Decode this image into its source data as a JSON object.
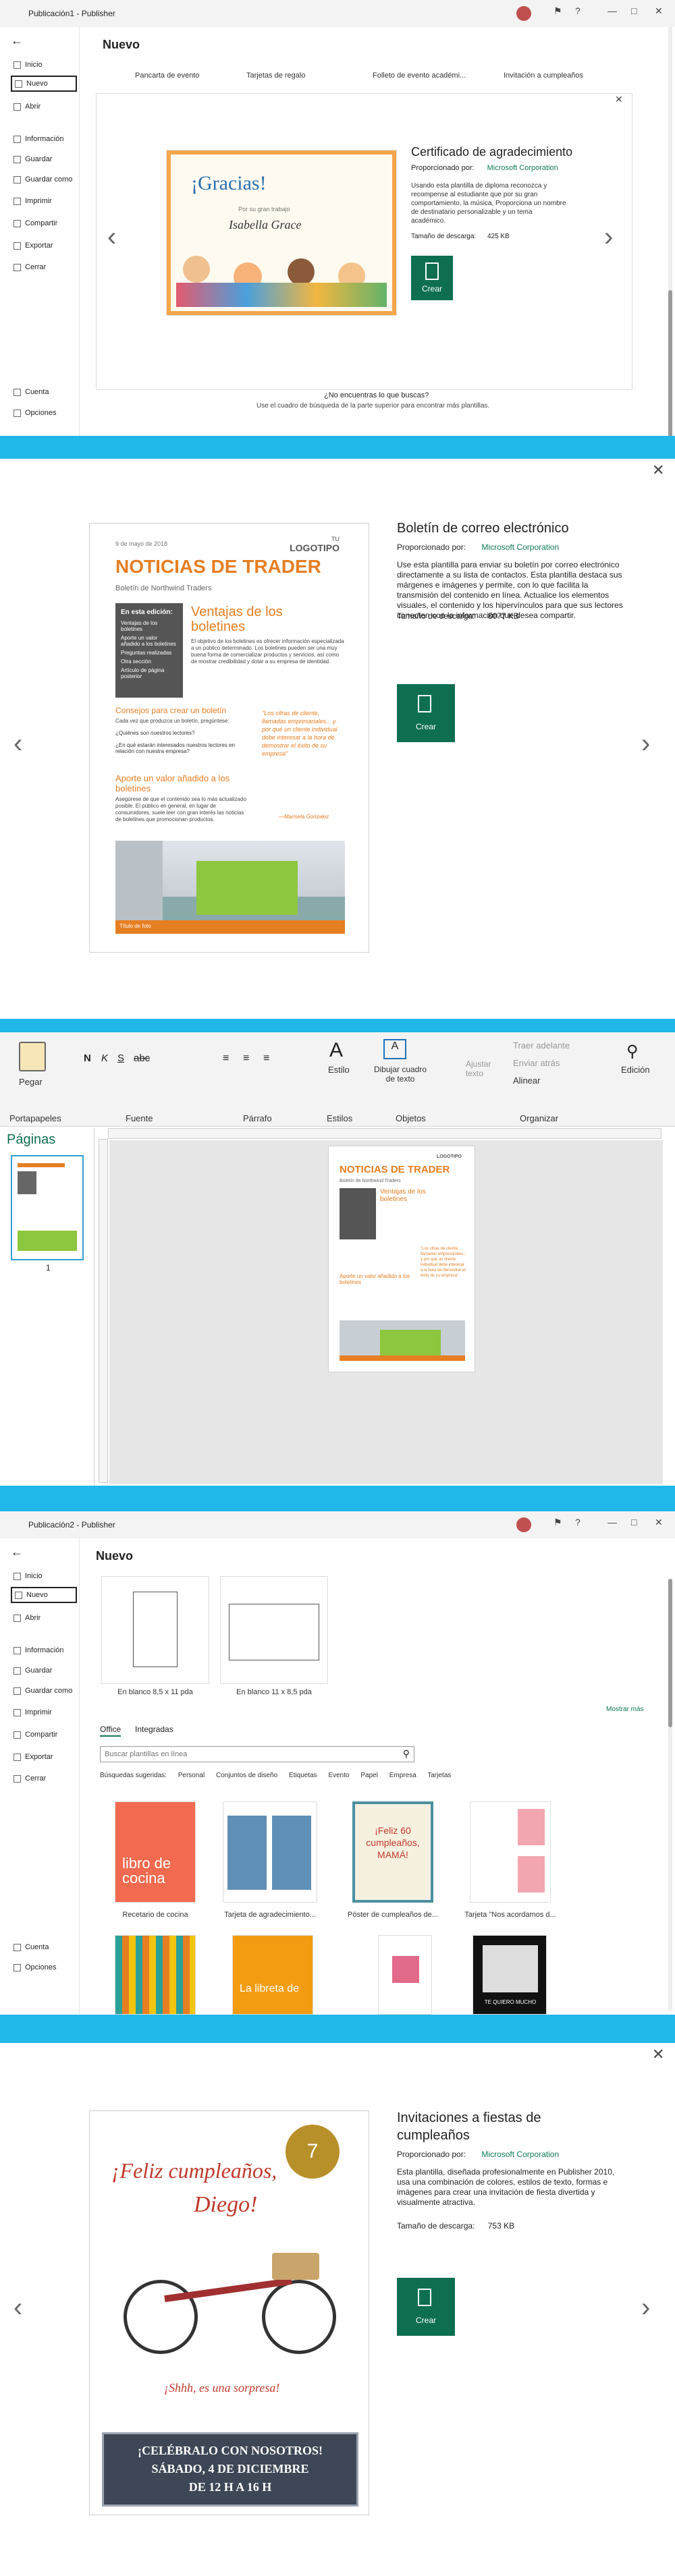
{
  "panel1": {
    "window_title": "Publicación1 - Publisher",
    "sidebar": [
      {
        "label": "Inicio"
      },
      {
        "label": "Nuevo"
      },
      {
        "label": "Abrir"
      },
      {
        "label": "Información"
      },
      {
        "label": "Guardar"
      },
      {
        "label": "Guardar como"
      },
      {
        "label": "Imprimir"
      },
      {
        "label": "Compartir"
      },
      {
        "label": "Exportar"
      },
      {
        "label": "Cerrar"
      },
      {
        "label": "Cuenta"
      },
      {
        "label": "Opciones"
      }
    ],
    "heading": "Nuevo",
    "templates": [
      "Pancarta de evento",
      "Tarjetas de regalo",
      "Folleto de evento académi...",
      "Invitación a cumpleaños"
    ],
    "cert": {
      "gracias": "¡Gracias!",
      "line1": "Isabella Grace",
      "line2": "Por su gran trabajo"
    },
    "detail": {
      "title": "Certificado de agradecimiento",
      "provided_label": "Proporcionado por:",
      "provider": "Microsoft Corporation",
      "desc": "Usando esta plantilla de diploma reconozca y recompense al estudiante que por su gran comportamiento, la música, Proporciona un nombre de destinatario personalizable y un tema académico.",
      "size_label": "Tamaño de descarga:",
      "size": "425 KB",
      "create": "Crear"
    },
    "not_found": "¿No encuentras lo que buscas?",
    "not_found_hint": "Use el cuadro de búsqueda de la parte superior para encontrar más plantillas."
  },
  "panel2": {
    "news": {
      "date": "9 de mayo de 2018",
      "logo_a": "TU",
      "logo_b": "LOGOTIPO",
      "title": "NOTICIAS DE TRADER",
      "subtitle": "Boletín de Northwind Traders",
      "box_title": "En esta edición:",
      "box_items": [
        "Ventajas de los boletines",
        "Aporte un valor añadido a los boletines",
        "Preguntas realizadas",
        "Otra sección",
        "Artículo de página posterior"
      ],
      "h1": "Ventajas de los boletines",
      "p1": "El objetivo de los boletines es ofrecer información especializada a un público determinado. Los boletines pueden ser una muy buena forma de comercializar productos y servicios, así como de mostrar credibilidad y dotar a su empresa de identidad.",
      "h2": "Consejos para crear un boletín",
      "p2": "Cada vez que produzca un boletín, pregúntese:",
      "q1": "¿Quiénes son nuestros lectores?",
      "q2": "¿En qué estarán interesados nuestros lectores en relación con nuestra empresa?",
      "h3": "Aporte un valor añadido a los boletines",
      "p3": "Asegúrese de que el contenido sea lo más actualizado posible. El público en general, en lugar de consumidores, suele leer con gran interés las noticias de boletines que promocionan productos.",
      "quote": "\"Los cifras de cliente, llamadas empresariales... y por qué un cliente individual debe interesar a la hora de demostrar el éxito de su empresa\"",
      "quote_author": "—Marisela Gonzalez",
      "photo_caption": "Título de foto"
    },
    "detail": {
      "title": "Boletín de correo electrónico",
      "provided_label": "Proporcionado por:",
      "provider": "Microsoft Corporation",
      "desc": "Use esta plantilla para enviar su boletín por correo electrónico directamente a su lista de contactos. Esta plantilla destaca sus márgenes e imágenes y permite, con lo que facilita la transmisión del contenido en línea. Actualice los elementos visuales, el contenido y los hipervínculos para que sus lectores conecten con la información que desea compartir.",
      "size_label": "Tamaño de descarga:",
      "size": "8077 KB",
      "create": "Crear"
    }
  },
  "panel3": {
    "ribbon": {
      "paste": "Pegar",
      "portapapeles": "Portapapeles",
      "fuente": "Fuente",
      "parrafo": "Párrafo",
      "estilo": "Estilo",
      "estilos": "Estilos",
      "dibujar": "Dibujar cuadro de texto",
      "objetos": "Objetos",
      "traer": "Traer adelante",
      "enviar": "Enviar atrás",
      "ajustar": "Ajustar texto",
      "alinear": "Alinear",
      "organizar": "Organizar",
      "edicion": "Edición"
    },
    "pages_title": "Páginas",
    "page_number": "1"
  },
  "panel4": {
    "window_title": "Publicación2 - Publisher",
    "heading": "Nuevo",
    "blank1": "En blanco 8,5 x 11 pda",
    "blank2": "En blanco 11 x 8,5 pda",
    "more": "Mostrar más",
    "tabs": [
      "Office",
      "Integradas"
    ],
    "search_placeholder": "Buscar plantillas en línea",
    "suggestions": [
      "Búsquedas sugeridas:",
      "Personal",
      "Conjuntos de diseño",
      "Etiquetas",
      "Evento",
      "Papel",
      "Empresa",
      "Tarjetas"
    ],
    "templates": [
      "Recetario de cocina",
      "Tarjeta de agradecimiento...",
      "Póster de cumpleaños de...",
      "Tarjeta \"Nos acordamos d..."
    ],
    "tile_texts": {
      "cocina": "libro de cocina",
      "mama": "¡Feliz 60 cumpleaños, MAMÁ!",
      "libreta": "La libreta de",
      "quiero": "TE QUIERO MUCHO"
    }
  },
  "panel5": {
    "card": {
      "line1": "¡Feliz cumpleaños,",
      "line2": "Diego!",
      "badge": "7",
      "secret": "¡Shhh, es una sorpresa!",
      "box1": "¡CELÉBRALO CON NOSOTROS!",
      "box2": "SÁBADO, 4 DE DICIEMBRE",
      "box3": "DE 12 H A 16 H"
    },
    "detail": {
      "title": "Invitaciones a fiestas de cumpleaños",
      "provided_label": "Proporcionado por:",
      "provider": "Microsoft Corporation",
      "desc": "Esta plantilla, diseñada profesionalmente en Publisher 2010, usa una combinación de colores, estilos de texto, formas e imágenes para crear una invitación de fiesta divertida y visualmente atractiva.",
      "size_label": "Tamaño de descarga:",
      "size": "753 KB",
      "create": "Crear"
    }
  },
  "icons": [
    "back-arrow-icon",
    "close-icon",
    "chevron-left-icon",
    "chevron-right-icon",
    "file-icon",
    "paste-icon",
    "search-icon",
    "minimize-icon",
    "maximize-icon",
    "help-icon"
  ],
  "colors": {
    "accent": "#0f7b55",
    "news_orange": "#e67e22",
    "frame": "#20b8e8"
  }
}
